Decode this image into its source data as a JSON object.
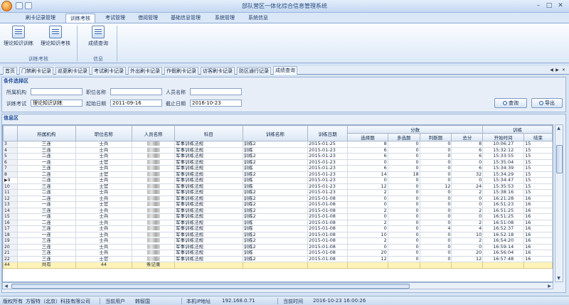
{
  "app": {
    "title": "部队营区一体化综合信息管理系统"
  },
  "menu": [
    "刷卡记录管理",
    "训练考核",
    "考试管理",
    "借阅管理",
    "基础信息管理",
    "系统管理",
    "系统信息"
  ],
  "ribbon": {
    "buttons": [
      {
        "label": "理论知识训练",
        "icon": "training-icon"
      },
      {
        "label": "理论知识考核",
        "icon": "exam-icon"
      },
      {
        "label": "成绩查询",
        "icon": "score-query-icon"
      }
    ],
    "groups": [
      "训练考核",
      "信息"
    ]
  },
  "tabs": [
    "首页",
    "门禁刷卡记录",
    "巡更刷卡记录",
    "考试刷卡记录",
    "外出刷卡记录",
    "作假刷卡记录",
    "访客刷卡记录",
    "防区通行记录",
    "成绩查询"
  ],
  "filter": {
    "title": "条件选择区",
    "unit_label": "所属机构",
    "unit_value": "",
    "position_label": "职位名称",
    "position_value": "",
    "person_label": "人员名称",
    "person_value": "",
    "training_label": "训练考试",
    "training_value": "理论知识训练",
    "start_label": "起始日期",
    "start_value": "2011-09-16",
    "end_label": "截止日期",
    "end_value": "2016-10-23",
    "query_button": "查询",
    "export_button": "导出"
  },
  "info": {
    "title": "信息区"
  },
  "table": {
    "headers": {
      "unit": "所属机构",
      "position": "职位名称",
      "person": "人员名称",
      "subject": "科目",
      "training": "训练名称",
      "date": "训练日期",
      "score_group": "分数",
      "choice": "选择题",
      "multi": "多选题",
      "judge": "判断题",
      "total": "总分",
      "train_group": "训练",
      "start": "开始时间",
      "end": "结束"
    },
    "rows": [
      [
        "3",
        "三连",
        "士兵",
        "军事训练法规",
        "训练2",
        "2015-01-25",
        "8",
        "0",
        "0",
        "8",
        "10:06:27",
        "15"
      ],
      [
        "4",
        "三连",
        "士兵",
        "军事训练法规",
        "训练",
        "2015-01-23",
        "6",
        "0",
        "0",
        "6",
        "15:32:12",
        "15"
      ],
      [
        "5",
        "二连",
        "士兵",
        "军事训练法规",
        "训练2",
        "2015-01-23",
        "6",
        "0",
        "0",
        "6",
        "15:33:55",
        "15"
      ],
      [
        "6",
        "一连",
        "士官",
        "军事训练法规",
        "训练2",
        "2015-01-23",
        "0",
        "0",
        "0",
        "0",
        "15:35:04",
        "15"
      ],
      [
        "7",
        "三连",
        "士兵",
        "军事训练法规",
        "训练",
        "2015-01-23",
        "6",
        "0",
        "0",
        "6",
        "15:34:39",
        "15"
      ],
      [
        "8",
        "二连",
        "士官",
        "军事训练法规",
        "训练2",
        "2015-01-23",
        "14",
        "18",
        "0",
        "32",
        "15:34:29",
        "15"
      ],
      [
        "9",
        "二连",
        "士兵",
        "军事训练法规",
        "训练",
        "2015-01-23",
        "0",
        "0",
        "0",
        "0",
        "15:34:47",
        "15"
      ],
      [
        "10",
        "三连",
        "士官",
        "军事训练法规",
        "训练",
        "2015-01-23",
        "12",
        "0",
        "12",
        "24",
        "15:35:53",
        "15"
      ],
      [
        "11",
        "二连",
        "士兵",
        "军事训练法规",
        "训练2",
        "2015-01-23",
        "2",
        "0",
        "0",
        "2",
        "15:38:16",
        "15"
      ],
      [
        "12",
        "二连",
        "士兵",
        "军事训练法规",
        "训练2",
        "2015-01-08",
        "0",
        "0",
        "0",
        "0",
        "16:21:28",
        "16"
      ],
      [
        "13",
        "一连",
        "士官",
        "军事训练法规",
        "训练2",
        "2015-01-08",
        "0",
        "0",
        "0",
        "0",
        "16:51:23",
        "16"
      ],
      [
        "14",
        "三连",
        "士兵",
        "军事训练法规",
        "训练2",
        "2015-01-08",
        "2",
        "0",
        "0",
        "2",
        "16:51:25",
        "16"
      ],
      [
        "15",
        "一连",
        "士兵",
        "军事训练法规",
        "训练2",
        "2015-01-08",
        "0",
        "0",
        "0",
        "0",
        "16:51:25",
        "16"
      ],
      [
        "16",
        "二连",
        "士兵",
        "军事训练法规",
        "训练",
        "2015-01-08",
        "2",
        "0",
        "0",
        "2",
        "16:51:08",
        "16"
      ],
      [
        "17",
        "三连",
        "士兵",
        "军事训练法规",
        "训练",
        "2015-01-08",
        "0",
        "0",
        "4",
        "4",
        "16:52:37",
        "16"
      ],
      [
        "18",
        "一连",
        "士兵",
        "军事训练法规",
        "训练2",
        "2015-01-08",
        "10",
        "0",
        "0",
        "10",
        "16:52:18",
        "16"
      ],
      [
        "19",
        "三连",
        "士兵",
        "军事训练法规",
        "训练2",
        "2015-01-08",
        "2",
        "0",
        "0",
        "2",
        "16:54:20",
        "16"
      ],
      [
        "20",
        "三连",
        "士兵",
        "军事训练法规",
        "训练2",
        "2015-01-08",
        "0",
        "0",
        "0",
        "0",
        "16:59:14",
        "16"
      ],
      [
        "21",
        "三连",
        "士兵",
        "军事训练法规",
        "训练",
        "2015-01-08",
        "20",
        "0",
        "0",
        "20",
        "16:56:04",
        "16"
      ],
      [
        "22",
        "三连",
        "士官",
        "军事训练法规",
        "训练2",
        "2015-01-08",
        "12",
        "0",
        "0",
        "12",
        "16:57:48",
        "16"
      ]
    ],
    "total": {
      "label": "共有",
      "count": "44",
      "suffix": "条记录"
    }
  },
  "status": {
    "copyright_label": "版权所有",
    "company": "方智特（北京）科技有限公司",
    "user_label": "当前用户",
    "user": "韩智国",
    "ip_label": "本机IP地址",
    "ip": "192.168.0.71",
    "time_label": "当前时间",
    "time": "2016-10-23 16:00:26"
  }
}
